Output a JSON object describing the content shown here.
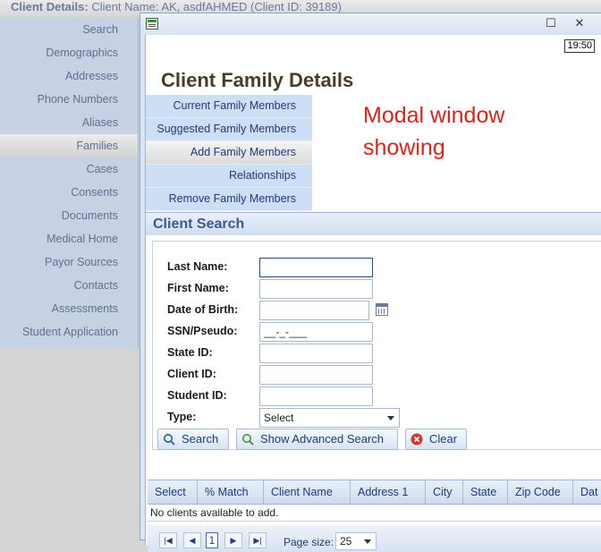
{
  "background": {
    "header_label": "Client Details:",
    "header_client": "Client Name: AK, asdfAHMED (Client ID: 39189)",
    "sidebar_items": [
      {
        "label": "Search"
      },
      {
        "label": "Demographics"
      },
      {
        "label": "Addresses"
      },
      {
        "label": "Phone Numbers"
      },
      {
        "label": "Aliases"
      },
      {
        "label": "Families"
      },
      {
        "label": "Cases"
      },
      {
        "label": "Consents"
      },
      {
        "label": "Documents"
      },
      {
        "label": "Medical Home"
      },
      {
        "label": "Payor Sources"
      },
      {
        "label": "Contacts"
      },
      {
        "label": "Assessments"
      },
      {
        "label": "Student Application"
      }
    ],
    "active_item": "Families"
  },
  "modal": {
    "maximize_glyph": "☐",
    "close_glyph": "✕",
    "time": "19:50",
    "title": "Client Family Details",
    "tabs": [
      {
        "label": "Current Family Members"
      },
      {
        "label": "Suggested Family Members"
      },
      {
        "label": "Add Family Members"
      },
      {
        "label": "Relationships"
      },
      {
        "label": "Remove Family Members"
      }
    ],
    "active_tab": "Add Family Members",
    "annotation_line1": "Modal window",
    "annotation_line2": "showing",
    "annotation_color": "#e0221b"
  },
  "search": {
    "section_title": "Client Search",
    "fields": {
      "last_name": {
        "label": "Last Name:",
        "value": ""
      },
      "first_name": {
        "label": "First Name:",
        "value": ""
      },
      "dob": {
        "label": "Date of Birth:",
        "value": ""
      },
      "ssn": {
        "label": "SSN/Pseudo:",
        "value": "__-_-___"
      },
      "state_id": {
        "label": "State ID:",
        "value": ""
      },
      "client_id": {
        "label": "Client ID:",
        "value": ""
      },
      "student_id": {
        "label": "Student ID:",
        "value": ""
      },
      "type": {
        "label": "Type:",
        "value": "Select"
      }
    },
    "buttons": {
      "search": "Search",
      "advanced": "Show Advanced Search",
      "clear": "Clear"
    }
  },
  "results": {
    "columns": [
      "Select",
      "% Match",
      "Client Name",
      "Address 1",
      "City",
      "State",
      "Zip Code",
      "Dat"
    ],
    "empty_message": "No clients available to add.",
    "current_page": "1",
    "page_size_label": "Page size:",
    "page_size": "25"
  },
  "colors": {
    "accent": "#1f3a7a",
    "section_title": "#3b5a8e",
    "sidebar_bg": "#c6d2e4"
  }
}
